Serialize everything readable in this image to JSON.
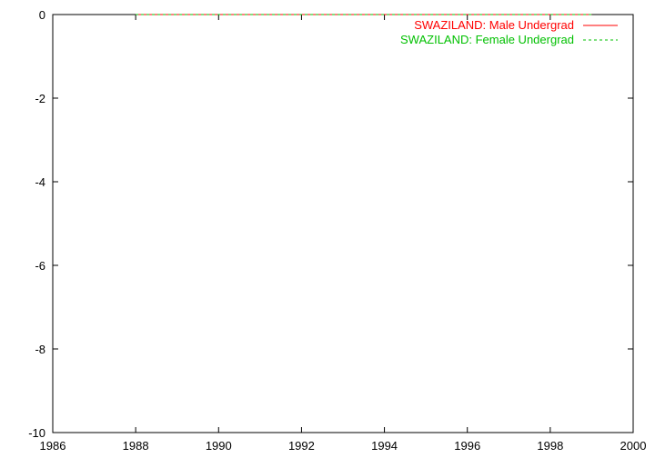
{
  "chart_data": {
    "type": "line",
    "title": "",
    "xlabel": "",
    "ylabel": "",
    "xlim": [
      1986,
      2000
    ],
    "ylim": [
      -10,
      0
    ],
    "x_ticks": [
      1986,
      1988,
      1990,
      1992,
      1994,
      1996,
      1998,
      2000
    ],
    "y_ticks": [
      0,
      -2,
      -4,
      -6,
      -8,
      -10
    ],
    "x_tick_labels": [
      "1986",
      "1988",
      "1990",
      "1992",
      "1994",
      "1996",
      "1998",
      "2000"
    ],
    "y_tick_labels": [
      "0",
      "-2",
      "-4",
      "-6",
      "-8",
      "-10"
    ],
    "grid": false,
    "legend_position": "top-right",
    "series": [
      {
        "name": "SWAZILAND: Male Undergrad",
        "color": "#ff0000",
        "dash": "solid",
        "x": [
          1988,
          1989,
          1990,
          1991,
          1992,
          1993,
          1994,
          1995,
          1996,
          1997,
          1998,
          1999
        ],
        "y": [
          0,
          0,
          0,
          0,
          0,
          0,
          0,
          0,
          0,
          0,
          0,
          0
        ]
      },
      {
        "name": "SWAZILAND: Female Undergrad",
        "color": "#00c000",
        "dash": "dashed",
        "x": [
          1988,
          1989,
          1990,
          1991,
          1992,
          1993,
          1994,
          1995,
          1996,
          1997,
          1998,
          1999
        ],
        "y": [
          0,
          0,
          0,
          0,
          0,
          0,
          0,
          0,
          0,
          0,
          0,
          0
        ]
      }
    ]
  }
}
